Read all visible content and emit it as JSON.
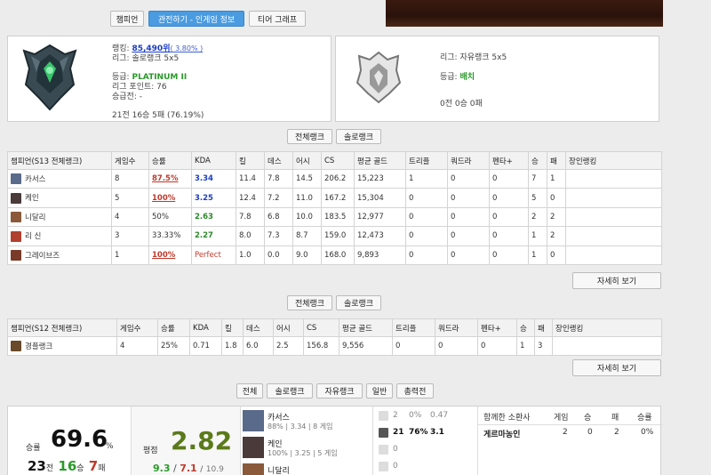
{
  "nav": {
    "tabs": [
      {
        "label": "챔피언",
        "active": false
      },
      {
        "label": "관전하기 - 인게임 정보",
        "active": true
      },
      {
        "label": "티어 그래프",
        "active": false
      }
    ]
  },
  "solo_card": {
    "ranking_label": "랭킹:",
    "ranking_value": "85,490위",
    "ranking_pct": "( 3.80% )",
    "league": "리그: 솔로랭크 5x5",
    "tier_label": "등급:",
    "tier_value": "PLATINUM II",
    "league_points": "리그 포인트: 76",
    "promo": "승급전: -",
    "record": "21전 16승 5패 (76.19%)"
  },
  "flex_card": {
    "league": "리그: 자유랭크 5x5",
    "tier_label": "등급:",
    "tier_value": "배치",
    "record": "0전 0승 0패"
  },
  "s13": {
    "filters": [
      "전체랭크",
      "솔로랭크"
    ],
    "headers": [
      "챔피언(S13 전체랭크)",
      "게임수",
      "승률",
      "KDA",
      "킬",
      "데스",
      "어시",
      "CS",
      "평균 골드",
      "트리플",
      "쿼드라",
      "펜타+",
      "승",
      "패",
      "장인랭킹"
    ],
    "rows": [
      {
        "champ": "카서스",
        "games": "8",
        "winrate": "87.5%",
        "kda": "3.34",
        "k": "11.4",
        "d": "7.8",
        "a": "14.5",
        "cs": "206.2",
        "gold": "15,223",
        "triple": "1",
        "quadra": "0",
        "penta": "0",
        "w": "7",
        "l": "1",
        "rank": "",
        "wr_style": "red-ul",
        "kda_style": "blue",
        "icon": "#5a6a8a"
      },
      {
        "champ": "케인",
        "games": "5",
        "winrate": "100%",
        "kda": "3.25",
        "k": "12.4",
        "d": "7.2",
        "a": "11.0",
        "cs": "167.2",
        "gold": "15,304",
        "triple": "0",
        "quadra": "0",
        "penta": "0",
        "w": "5",
        "l": "0",
        "rank": "",
        "wr_style": "red-ul",
        "kda_style": "blue",
        "icon": "#4a3a3a"
      },
      {
        "champ": "니달리",
        "games": "4",
        "winrate": "50%",
        "kda": "2.63",
        "k": "7.8",
        "d": "6.8",
        "a": "10.0",
        "cs": "183.5",
        "gold": "12,977",
        "triple": "0",
        "quadra": "0",
        "penta": "0",
        "w": "2",
        "l": "2",
        "rank": "",
        "wr_style": "",
        "kda_style": "kda-green",
        "icon": "#8a5a3a"
      },
      {
        "champ": "리 신",
        "games": "3",
        "winrate": "33.33%",
        "kda": "2.27",
        "k": "8.0",
        "d": "7.3",
        "a": "8.7",
        "cs": "159.0",
        "gold": "12,473",
        "triple": "0",
        "quadra": "0",
        "penta": "0",
        "w": "1",
        "l": "2",
        "rank": "",
        "wr_style": "",
        "kda_style": "kda-green",
        "icon": "#b04030"
      },
      {
        "champ": "그레이브즈",
        "games": "1",
        "winrate": "100%",
        "kda": "Perfect",
        "k": "1.0",
        "d": "0.0",
        "a": "9.0",
        "cs": "168.0",
        "gold": "9,893",
        "triple": "0",
        "quadra": "0",
        "penta": "0",
        "w": "1",
        "l": "0",
        "rank": "",
        "wr_style": "red-ul",
        "kda_style": "perfect",
        "icon": "#7a3a2a"
      }
    ],
    "more": "자세히 보기"
  },
  "s12": {
    "filters": [
      "전체랭크",
      "솔로랭크"
    ],
    "headers": [
      "챔피언(S12 전체랭크)",
      "게임수",
      "승률",
      "KDA",
      "킬",
      "데스",
      "어시",
      "CS",
      "평균 골드",
      "트리플",
      "쿼드라",
      "펜타+",
      "승",
      "패",
      "장인랭킹"
    ],
    "rows": [
      {
        "champ": "경플랭크",
        "games": "4",
        "winrate": "25%",
        "kda": "0.71",
        "k": "1.8",
        "d": "6.0",
        "a": "2.5",
        "cs": "156.8",
        "gold": "9,556",
        "triple": "0",
        "quadra": "0",
        "penta": "0",
        "w": "1",
        "l": "3",
        "rank": "",
        "icon": "#6a4a2a"
      }
    ],
    "more": "자세히 보기"
  },
  "match_filters": [
    "전체",
    "솔로랭크",
    "자유랭크",
    "일반",
    "총력전"
  ],
  "summary": {
    "winrate_label": "승률",
    "winrate_value": "69.6",
    "winrate_unit": "%",
    "games": "23",
    "games_unit": "전",
    "wins": "16",
    "wins_unit": "승",
    "losses": "7",
    "losses_unit": "패",
    "rating_label": "평점",
    "rating_value": "2.82",
    "k": "9.3",
    "d": "7.1",
    "a": "10.9"
  },
  "recent_champs": [
    {
      "name": "카서스",
      "line": "88% | 3.34 | 8 게임",
      "icon": "#5a6a8a"
    },
    {
      "name": "케인",
      "line": "100% | 3.25 | 5 게임",
      "icon": "#4a3a3a"
    },
    {
      "name": "니달리",
      "line": "",
      "icon": "#8a5a3a"
    }
  ],
  "positions": [
    {
      "games": "2",
      "pct": "0%",
      "kda": "0.47",
      "bold": false
    },
    {
      "games": "21",
      "pct": "76%",
      "kda": "3.1",
      "bold": true
    },
    {
      "games": "0",
      "pct": "",
      "kda": "",
      "bold": false
    },
    {
      "games": "0",
      "pct": "",
      "kda": "",
      "bold": false
    }
  ],
  "duo": {
    "headers": [
      "함께한 소환사",
      "게임",
      "승",
      "패",
      "승률"
    ],
    "rows": [
      {
        "name": "게르마농인",
        "games": "2",
        "w": "0",
        "l": "2",
        "wr": "0%"
      }
    ]
  }
}
